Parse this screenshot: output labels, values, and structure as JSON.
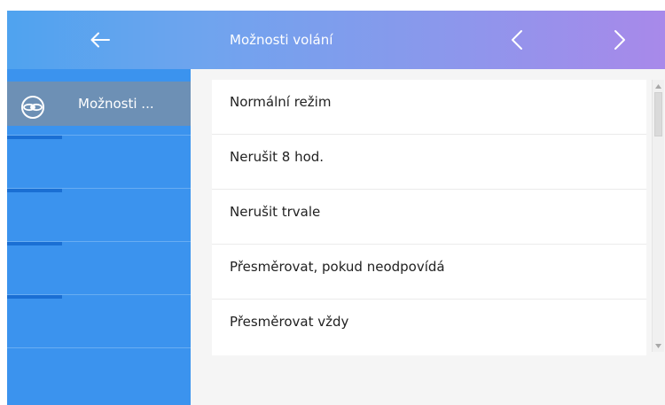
{
  "header": {
    "title": "Možnosti volání",
    "back_icon": "arrow-left-icon",
    "prev_icon": "chevron-left-icon",
    "next_icon": "chevron-right-icon"
  },
  "sidebar": {
    "items": [
      {
        "label": "Možnosti ...",
        "icon": "call-options-icon",
        "selected": true
      },
      {
        "label": ""
      },
      {
        "label": ""
      },
      {
        "label": ""
      },
      {
        "label": ""
      }
    ]
  },
  "list": {
    "items": [
      {
        "label": "Normální režim"
      },
      {
        "label": "Nerušit 8 hod."
      },
      {
        "label": "Nerušit trvale"
      },
      {
        "label": "Přesměrovat, pokud neodpovídá"
      },
      {
        "label": "Přesměrovat vždy"
      }
    ]
  },
  "colors": {
    "header_gradient": [
      "#4fa3ef",
      "#a889ea"
    ],
    "sidebar": "#3b93ee",
    "sidebar_selected": "#6d90b5",
    "content_bg": "#f5f5f5"
  }
}
